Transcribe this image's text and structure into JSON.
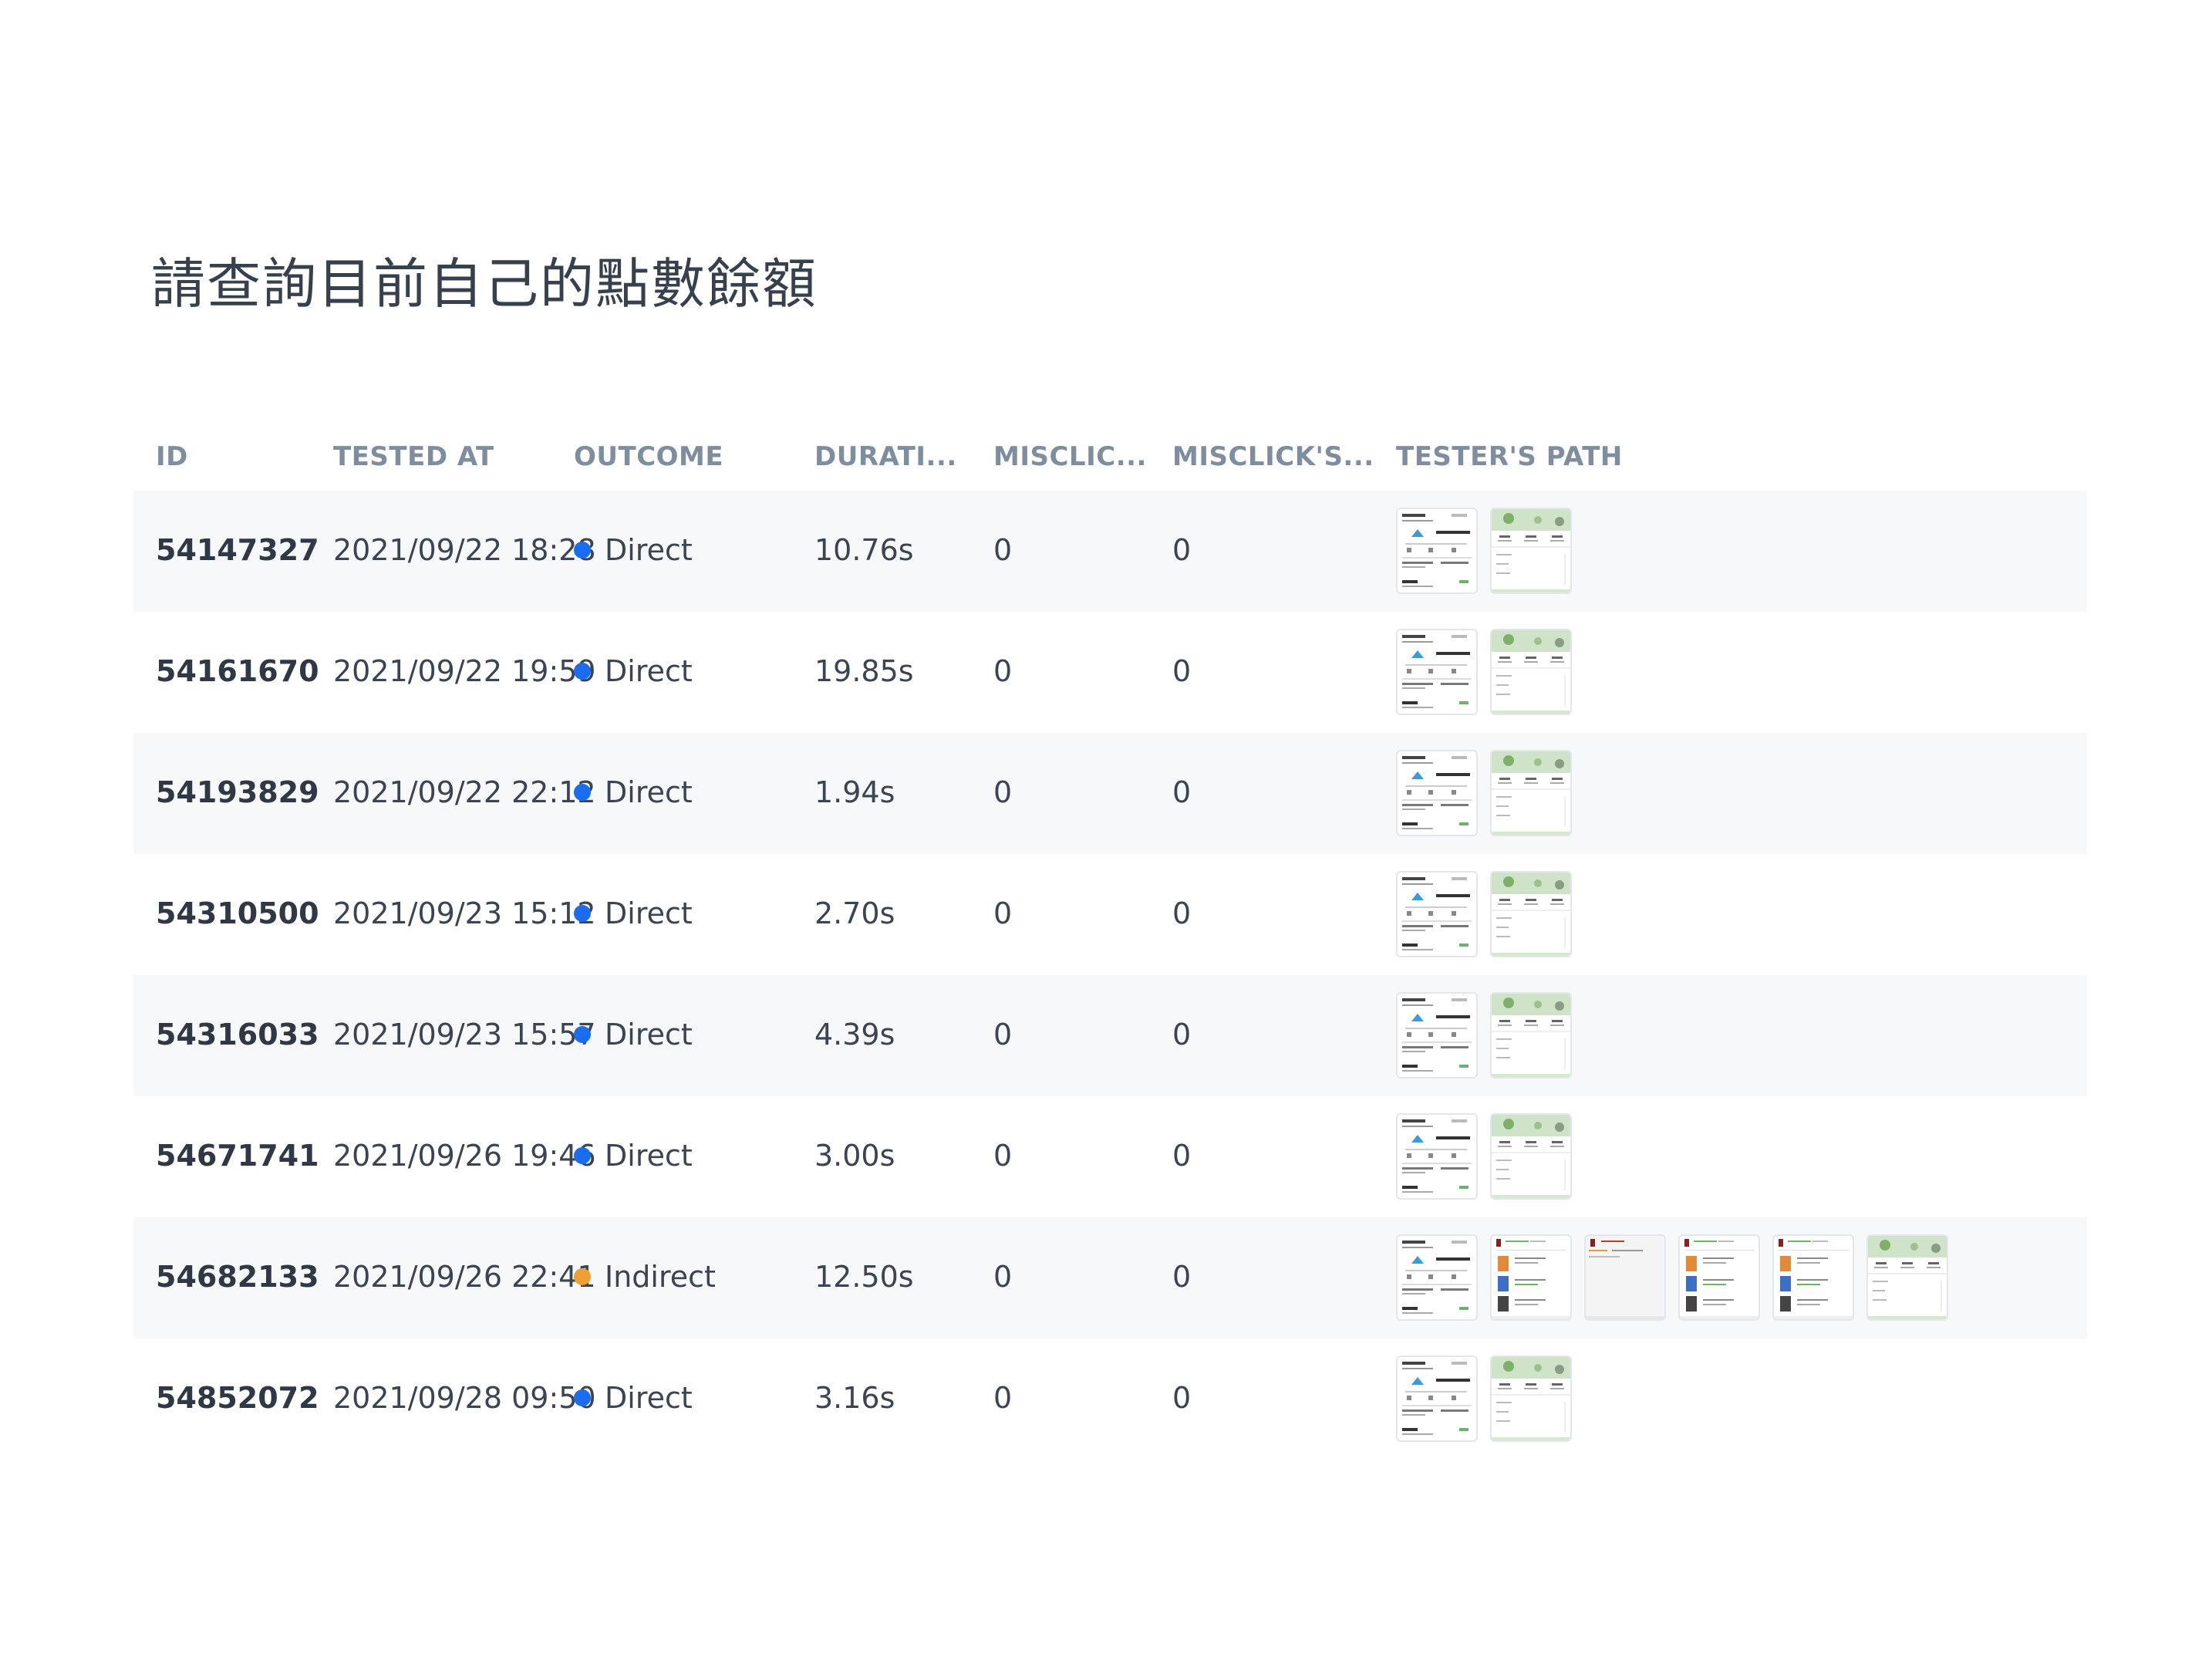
{
  "page": {
    "title": "請查詢目前自己的點數餘額"
  },
  "table": {
    "columns": [
      "ID",
      "TESTED AT",
      "OUTCOME",
      "DURATI...",
      "MISCLIC...",
      "MISCLICK'S...",
      "TESTER'S PATH"
    ],
    "rows": [
      {
        "id": "54147327",
        "tested_at": "2021/09/22 18:28",
        "outcome": "Direct",
        "duration": "10.76s",
        "misclicks": "0",
        "misclick_rate": "0",
        "path": [
          "home-screen",
          "points-screen"
        ]
      },
      {
        "id": "54161670",
        "tested_at": "2021/09/22 19:59",
        "outcome": "Direct",
        "duration": "19.85s",
        "misclicks": "0",
        "misclick_rate": "0",
        "path": [
          "home-screen",
          "points-screen"
        ]
      },
      {
        "id": "54193829",
        "tested_at": "2021/09/22 22:12",
        "outcome": "Direct",
        "duration": "1.94s",
        "misclicks": "0",
        "misclick_rate": "0",
        "path": [
          "home-screen",
          "points-screen"
        ]
      },
      {
        "id": "54310500",
        "tested_at": "2021/09/23 15:12",
        "outcome": "Direct",
        "duration": "2.70s",
        "misclicks": "0",
        "misclick_rate": "0",
        "path": [
          "home-screen",
          "points-screen"
        ]
      },
      {
        "id": "54316033",
        "tested_at": "2021/09/23 15:57",
        "outcome": "Direct",
        "duration": "4.39s",
        "misclicks": "0",
        "misclick_rate": "0",
        "path": [
          "home-screen",
          "points-screen"
        ]
      },
      {
        "id": "54671741",
        "tested_at": "2021/09/26 19:46",
        "outcome": "Direct",
        "duration": "3.00s",
        "misclicks": "0",
        "misclick_rate": "0",
        "path": [
          "home-screen",
          "points-screen"
        ]
      },
      {
        "id": "54682133",
        "tested_at": "2021/09/26 22:41",
        "outcome": "Indirect",
        "duration": "12.50s",
        "misclicks": "0",
        "misclick_rate": "0",
        "path": [
          "home-screen",
          "product-screen",
          "menu-screen",
          "product-screen",
          "product-screen",
          "points-screen"
        ]
      },
      {
        "id": "54852072",
        "tested_at": "2021/09/28 09:50",
        "outcome": "Direct",
        "duration": "3.16s",
        "misclicks": "0",
        "misclick_rate": "0",
        "path": [
          "home-screen",
          "points-screen"
        ]
      }
    ]
  },
  "colors": {
    "direct": "#1a6cf0",
    "indirect": "#f0a030",
    "row_shade": "#f7f8fa",
    "header_text": "#7e8ea0"
  }
}
